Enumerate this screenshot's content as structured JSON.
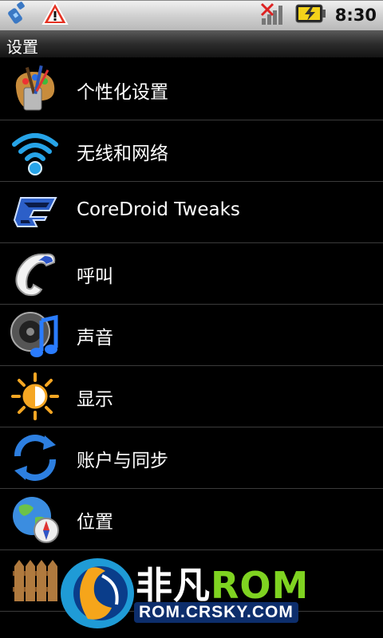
{
  "status_bar": {
    "time": "8:30",
    "left_icons": [
      "usb-debug-icon",
      "warning-icon"
    ],
    "right_icons": [
      "no-signal-icon",
      "battery-charging-icon"
    ]
  },
  "title": "设置",
  "settings": [
    {
      "label": "个性化设置",
      "icon": "personalization-icon"
    },
    {
      "label": "无线和网络",
      "icon": "wifi-icon"
    },
    {
      "label": "CoreDroid Tweaks",
      "icon": "coredroid-icon"
    },
    {
      "label": "呼叫",
      "icon": "phone-handset-icon"
    },
    {
      "label": "声音",
      "icon": "speaker-music-icon"
    },
    {
      "label": "显示",
      "icon": "brightness-icon"
    },
    {
      "label": "账户与同步",
      "icon": "sync-icon"
    },
    {
      "label": "位置",
      "icon": "globe-compass-icon"
    },
    {
      "label": "",
      "icon": "fence-icon"
    }
  ],
  "watermark": {
    "brand_cn": "非凡",
    "brand_rom": "ROM",
    "url": "ROM.CRSKY.COM"
  },
  "colors": {
    "accent_blue": "#1e88e5",
    "rom_green": "#7fd321",
    "divider": "#3b3b3b"
  }
}
